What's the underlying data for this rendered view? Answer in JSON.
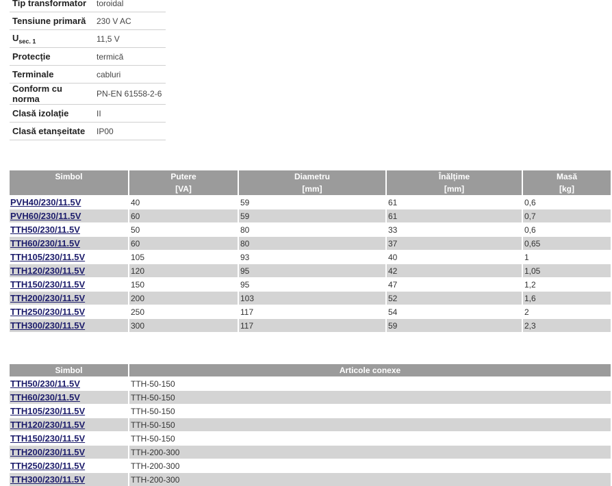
{
  "specs": [
    {
      "key": "Tip transformator",
      "value": "toroidal"
    },
    {
      "key": "Tensiune primară",
      "value": "230 V AC"
    },
    {
      "key": "U",
      "key_sub": "sec. 1",
      "value": "11,5 V"
    },
    {
      "key": "Protecție",
      "value": "termică"
    },
    {
      "key": "Terminale",
      "value": "cabluri"
    },
    {
      "key": "Conform cu norma",
      "value": "PN-EN 61558-2-6"
    },
    {
      "key": "Clasă izolație",
      "value": "II"
    },
    {
      "key": "Clasă etanșeitate",
      "value": "IP00"
    }
  ],
  "table1": {
    "headers": [
      "Simbol",
      "Putere",
      "Diametru",
      "Înălțime",
      "Masă"
    ],
    "units": [
      "",
      "[VA]",
      "[mm]",
      "[mm]",
      "[kg]"
    ],
    "rows": [
      [
        "PVH40/230/11.5V",
        "40",
        "59",
        "61",
        "0,6"
      ],
      [
        "PVH60/230/11.5V",
        "60",
        "59",
        "61",
        "0,7"
      ],
      [
        "TTH50/230/11.5V",
        "50",
        "80",
        "33",
        "0,6"
      ],
      [
        "TTH60/230/11.5V",
        "60",
        "80",
        "37",
        "0,65"
      ],
      [
        "TTH105/230/11.5V",
        "105",
        "93",
        "40",
        "1"
      ],
      [
        "TTH120/230/11.5V",
        "120",
        "95",
        "42",
        "1,05"
      ],
      [
        "TTH150/230/11.5V",
        "150",
        "95",
        "47",
        "1,2"
      ],
      [
        "TTH200/230/11.5V",
        "200",
        "103",
        "52",
        "1,6"
      ],
      [
        "TTH250/230/11.5V",
        "250",
        "117",
        "54",
        "2"
      ],
      [
        "TTH300/230/11.5V",
        "300",
        "117",
        "59",
        "2,3"
      ]
    ]
  },
  "table2": {
    "headers": [
      "Simbol",
      "Articole conexe"
    ],
    "rows": [
      [
        "TTH50/230/11.5V",
        "TTH-50-150"
      ],
      [
        "TTH60/230/11.5V",
        "TTH-50-150"
      ],
      [
        "TTH105/230/11.5V",
        "TTH-50-150"
      ],
      [
        "TTH120/230/11.5V",
        "TTH-50-150"
      ],
      [
        "TTH150/230/11.5V",
        "TTH-50-150"
      ],
      [
        "TTH200/230/11.5V",
        "TTH-200-300"
      ],
      [
        "TTH250/230/11.5V",
        "TTH-200-300"
      ],
      [
        "TTH300/230/11.5V",
        "TTH-200-300"
      ]
    ]
  }
}
